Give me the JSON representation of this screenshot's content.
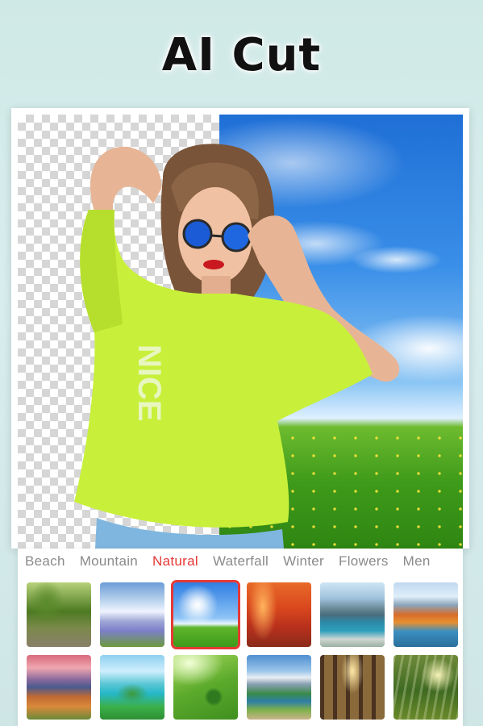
{
  "title": "AI Cut",
  "tabs": [
    {
      "label": "Beach",
      "active": false
    },
    {
      "label": "Mountain",
      "active": false
    },
    {
      "label": "Natural",
      "active": true
    },
    {
      "label": "Waterfall",
      "active": false
    },
    {
      "label": "Winter",
      "active": false
    },
    {
      "label": "Flowers",
      "active": false
    },
    {
      "label": "Men",
      "active": false
    }
  ],
  "colors": {
    "accent": "#e53935",
    "tab_inactive": "#8a8a8a",
    "background": "#d3ecea"
  },
  "thumbnails": [
    {
      "name": "tree-road",
      "selected": false
    },
    {
      "name": "lavender-sky",
      "selected": false
    },
    {
      "name": "sky-grass",
      "selected": true
    },
    {
      "name": "autumn-forest",
      "selected": false
    },
    {
      "name": "lake-mountains",
      "selected": false
    },
    {
      "name": "autumn-lake",
      "selected": false
    },
    {
      "name": "sunset-valley",
      "selected": false
    },
    {
      "name": "tropical-islands",
      "selected": false
    },
    {
      "name": "green-field-tree",
      "selected": false
    },
    {
      "name": "mountain-lake-road",
      "selected": false
    },
    {
      "name": "sunlit-forest",
      "selected": false
    },
    {
      "name": "forest-sunbeams",
      "selected": false
    }
  ]
}
